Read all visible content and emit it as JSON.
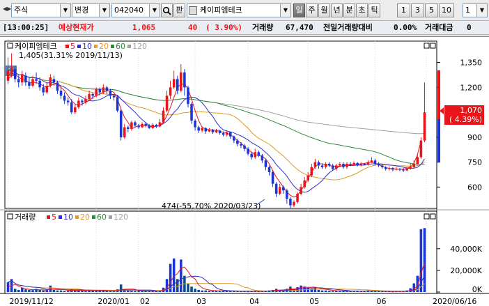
{
  "toolbar": {
    "market": "주식",
    "change_label": "변경",
    "code": "042040",
    "panel_label": "판",
    "name": "케이피엠테크",
    "periods": [
      "일",
      "주",
      "월",
      "년",
      "분",
      "초",
      "틱"
    ],
    "active_period": "일",
    "intervals": [
      "1",
      "3",
      "5",
      "10"
    ],
    "interval_value": "1"
  },
  "quote": {
    "time": "[13:00:25]",
    "label": "예상현재가",
    "price": "1,065",
    "change": "40",
    "change_pct": "( 3.90%)",
    "volume_label": "거래량",
    "volume": "67,470",
    "prev_vol_label": "전일거래량대비",
    "prev_vol_pct": "0.00%",
    "amount_label": "거래대금",
    "amount": "0"
  },
  "colors": {
    "up": "#e8161b",
    "down": "#1a35d6",
    "ma5": "#e8161b",
    "ma10": "#3030c8",
    "ma20": "#e09a20",
    "ma60": "#2a8a3a",
    "ma120": "#a0a0a0"
  },
  "chart_data": [
    {
      "type": "candlestick",
      "title": "케이피엠테크",
      "legend": [
        "5",
        "10",
        "20",
        "60",
        "120"
      ],
      "ylim": [
        480,
        1470
      ],
      "yticks": [
        "1,350",
        "1,200",
        "900",
        "750",
        "600"
      ],
      "xticks": [
        "2019/11/12",
        "2020/01",
        "02",
        "03",
        "04",
        "05",
        "06",
        "2020/06/16"
      ],
      "current_price": "1,070",
      "current_pct": "( 4.39%)",
      "high_annotation": "1,405(31.31% 2019/11/13)",
      "low_annotation": "474(-55.70% 2020/03/23)",
      "candles": [
        [
          1240,
          1300,
          1380,
          1220
        ],
        [
          1280,
          1320,
          1405,
          1260
        ],
        [
          1310,
          1250,
          1330,
          1230
        ],
        [
          1250,
          1230,
          1280,
          1200
        ],
        [
          1230,
          1280,
          1300,
          1210
        ],
        [
          1270,
          1230,
          1290,
          1210
        ],
        [
          1230,
          1210,
          1260,
          1190
        ],
        [
          1210,
          1250,
          1270,
          1200
        ],
        [
          1250,
          1240,
          1290,
          1220
        ],
        [
          1240,
          1200,
          1260,
          1180
        ],
        [
          1200,
          1170,
          1220,
          1150
        ],
        [
          1170,
          1210,
          1230,
          1160
        ],
        [
          1210,
          1260,
          1280,
          1200
        ],
        [
          1250,
          1230,
          1270,
          1210
        ],
        [
          1230,
          1180,
          1240,
          1160
        ],
        [
          1180,
          1150,
          1200,
          1130
        ],
        [
          1150,
          1120,
          1170,
          1100
        ],
        [
          1120,
          1110,
          1140,
          1090
        ],
        [
          1110,
          1050,
          1130,
          1040
        ],
        [
          1050,
          1080,
          1100,
          1040
        ],
        [
          1080,
          1120,
          1140,
          1070
        ],
        [
          1120,
          1110,
          1130,
          1090
        ],
        [
          1110,
          1130,
          1150,
          1100
        ],
        [
          1130,
          1160,
          1180,
          1120
        ],
        [
          1160,
          1150,
          1170,
          1130
        ],
        [
          1150,
          1190,
          1200,
          1140
        ],
        [
          1190,
          1170,
          1200,
          1150
        ],
        [
          1170,
          1200,
          1220,
          1160
        ],
        [
          1200,
          1180,
          1210,
          1160
        ],
        [
          1180,
          1150,
          1190,
          1130
        ],
        [
          1150,
          1140,
          1160,
          1120
        ],
        [
          1140,
          1060,
          1150,
          1050
        ],
        [
          1060,
          900,
          1070,
          880
        ],
        [
          900,
          960,
          980,
          890
        ],
        [
          960,
          950,
          970,
          930
        ],
        [
          950,
          990,
          1000,
          940
        ],
        [
          990,
          970,
          1000,
          960
        ],
        [
          970,
          960,
          980,
          950
        ],
        [
          960,
          980,
          990,
          955
        ],
        [
          980,
          970,
          990,
          960
        ],
        [
          970,
          955,
          980,
          950
        ],
        [
          955,
          975,
          985,
          950
        ],
        [
          975,
          965,
          980,
          955
        ],
        [
          965,
          990,
          1010,
          960
        ],
        [
          990,
          1060,
          1080,
          980
        ],
        [
          1060,
          1150,
          1180,
          1050
        ],
        [
          1150,
          1200,
          1240,
          1130
        ],
        [
          1200,
          1250,
          1300,
          1190
        ],
        [
          1250,
          1180,
          1270,
          1160
        ],
        [
          1180,
          1290,
          1340,
          1170
        ],
        [
          1290,
          1200,
          1310,
          1150
        ],
        [
          1200,
          1100,
          1210,
          1080
        ],
        [
          1100,
          1000,
          1110,
          980
        ],
        [
          1000,
          960,
          1010,
          940
        ],
        [
          960,
          940,
          970,
          925
        ],
        [
          940,
          955,
          965,
          930
        ],
        [
          955,
          935,
          960,
          920
        ],
        [
          935,
          945,
          955,
          930
        ],
        [
          945,
          930,
          950,
          920
        ],
        [
          930,
          940,
          950,
          925
        ],
        [
          940,
          925,
          945,
          915
        ],
        [
          925,
          915,
          935,
          905
        ],
        [
          915,
          930,
          940,
          905
        ],
        [
          930,
          905,
          935,
          890
        ],
        [
          905,
          880,
          910,
          865
        ],
        [
          880,
          860,
          890,
          845
        ],
        [
          860,
          850,
          870,
          835
        ],
        [
          850,
          830,
          860,
          815
        ],
        [
          830,
          800,
          840,
          790
        ],
        [
          800,
          780,
          810,
          765
        ],
        [
          780,
          810,
          830,
          770
        ],
        [
          810,
          790,
          820,
          780
        ],
        [
          790,
          760,
          800,
          745
        ],
        [
          760,
          720,
          770,
          700
        ],
        [
          720,
          690,
          730,
          670
        ],
        [
          690,
          620,
          700,
          600
        ],
        [
          620,
          560,
          630,
          540
        ],
        [
          560,
          600,
          620,
          550
        ],
        [
          600,
          580,
          610,
          560
        ],
        [
          580,
          530,
          590,
          500
        ],
        [
          530,
          490,
          540,
          474
        ],
        [
          490,
          510,
          520,
          480
        ],
        [
          510,
          560,
          570,
          500
        ],
        [
          560,
          600,
          620,
          550
        ],
        [
          600,
          640,
          660,
          590
        ],
        [
          640,
          670,
          690,
          630
        ],
        [
          670,
          720,
          740,
          660
        ],
        [
          720,
          750,
          770,
          710
        ],
        [
          750,
          730,
          760,
          710
        ],
        [
          730,
          720,
          740,
          710
        ],
        [
          720,
          740,
          750,
          710
        ],
        [
          740,
          730,
          750,
          720
        ],
        [
          730,
          710,
          740,
          700
        ],
        [
          710,
          730,
          740,
          700
        ],
        [
          730,
          740,
          750,
          720
        ],
        [
          740,
          720,
          750,
          710
        ],
        [
          720,
          740,
          750,
          710
        ],
        [
          740,
          735,
          750,
          725
        ],
        [
          735,
          745,
          755,
          730
        ],
        [
          745,
          730,
          750,
          725
        ],
        [
          730,
          740,
          750,
          725
        ],
        [
          740,
          735,
          745,
          730
        ],
        [
          735,
          750,
          760,
          730
        ],
        [
          750,
          760,
          780,
          745
        ],
        [
          760,
          740,
          770,
          730
        ],
        [
          740,
          730,
          750,
          720
        ],
        [
          730,
          720,
          740,
          710
        ],
        [
          720,
          710,
          725,
          700
        ],
        [
          710,
          715,
          725,
          700
        ],
        [
          715,
          705,
          720,
          695
        ],
        [
          705,
          710,
          720,
          700
        ],
        [
          710,
          705,
          715,
          695
        ],
        [
          705,
          700,
          715,
          690
        ],
        [
          700,
          710,
          720,
          695
        ],
        [
          710,
          720,
          740,
          705
        ],
        [
          720,
          740,
          760,
          715
        ],
        [
          740,
          780,
          800,
          735
        ],
        [
          780,
          880,
          900,
          770
        ],
        [
          880,
          1050,
          1230,
          870
        ]
      ],
      "ma5": [
        1250,
        1270,
        1280,
        1260,
        1250,
        1240,
        1230,
        1230,
        1230,
        1220,
        1210,
        1200,
        1210,
        1220,
        1220,
        1200,
        1180,
        1150,
        1120,
        1100,
        1090,
        1100,
        1110,
        1120,
        1140,
        1150,
        1160,
        1170,
        1180,
        1180,
        1170,
        1130,
        1070,
        1020,
        990,
        950,
        960,
        970,
        970,
        970,
        970,
        965,
        965,
        970,
        990,
        1030,
        1080,
        1140,
        1200,
        1220,
        1220,
        1190,
        1130,
        1060,
        1000,
        960,
        950,
        945,
        945,
        940,
        935,
        930,
        925,
        915,
        900,
        880,
        865,
        845,
        825,
        810,
        795,
        790,
        785,
        770,
        740,
        700,
        660,
        630,
        600,
        570,
        550,
        540,
        550,
        580,
        610,
        650,
        690,
        720,
        740,
        740,
        735,
        730,
        725,
        725,
        725,
        730,
        735,
        735,
        735,
        738,
        740,
        742,
        748,
        750,
        745,
        735,
        725,
        718,
        712,
        710,
        708,
        706,
        708,
        712,
        722,
        745,
        795,
        880
      ]
    },
    {
      "type": "bar",
      "title": "거래량",
      "legend": [
        "5",
        "10",
        "20",
        "60",
        "120"
      ],
      "ylim": [
        0,
        63000
      ],
      "yticks": [
        "40,000K",
        "20,000K",
        "0K"
      ],
      "values": [
        9000,
        12000,
        3000,
        2000,
        4000,
        2500,
        2000,
        1800,
        3000,
        2000,
        1500,
        1800,
        6000,
        2000,
        1500,
        1500,
        1200,
        1000,
        2500,
        2000,
        1500,
        1200,
        1000,
        1500,
        1000,
        1800,
        1200,
        1500,
        1000,
        900,
        800,
        2500,
        7000,
        2000,
        1500,
        1200,
        1000,
        900,
        800,
        900,
        800,
        900,
        700,
        1500,
        4000,
        12000,
        26000,
        31000,
        12000,
        30000,
        15000,
        8000,
        5000,
        3000,
        2000,
        1500,
        1500,
        1200,
        1000,
        1000,
        900,
        900,
        1000,
        900,
        800,
        800,
        700,
        800,
        900,
        800,
        700,
        600,
        800,
        1200,
        1500,
        2000,
        3000,
        2000,
        1500,
        3000,
        5000,
        2500,
        4500,
        6000,
        5000,
        4000,
        3000,
        4500,
        2000,
        1500,
        1500,
        1200,
        1000,
        1000,
        900,
        1000,
        800,
        900,
        800,
        900,
        800,
        1200,
        1500,
        1000,
        800,
        700,
        600,
        700,
        600,
        500,
        600,
        700,
        800,
        1500,
        3500,
        8000,
        15000,
        58000,
        59000
      ],
      "ma5": [
        5000,
        6000,
        7000,
        5500,
        4000,
        3000,
        2500,
        2200,
        2300,
        2100,
        2000,
        1900,
        2800,
        2900,
        2800,
        2500,
        2300,
        1500,
        1600,
        1700,
        1700,
        1600,
        1500,
        1400,
        1300,
        1400,
        1300,
        1400,
        1300,
        1300,
        1100,
        1400,
        2300,
        2600,
        2700,
        2800,
        2500,
        1300,
        1100,
        950,
        900,
        850,
        800,
        950,
        1600,
        3900,
        8800,
        14700,
        17000,
        22000,
        23000,
        19000,
        14000,
        12000,
        6600,
        3900,
        2600,
        1900,
        1500,
        1300,
        1200,
        1000,
        1000,
        950,
        900,
        860,
        820,
        800,
        800,
        800,
        760,
        700,
        720,
        800,
        960,
        1220,
        1680,
        1880,
        2000,
        2300,
        2900,
        2800,
        3300,
        4200,
        4600,
        4400,
        4500,
        4500,
        3800,
        3000,
        2500,
        2100,
        1600,
        1300,
        1100,
        1000,
        920,
        900,
        880,
        880,
        840,
        920,
        1000,
        1040,
        1040,
        1040,
        920,
        720,
        640,
        620,
        620,
        620,
        640,
        880,
        1420,
        2920,
        5760,
        17200,
        26900
      ]
    }
  ]
}
